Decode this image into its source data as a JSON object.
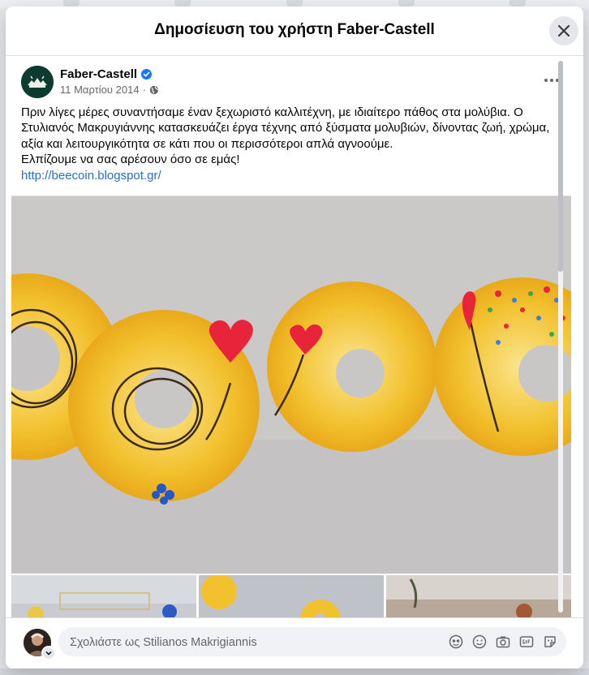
{
  "modal": {
    "title": "Δημοσίευση του χρήστη Faber-Castell"
  },
  "post": {
    "page_name": "Faber-Castell",
    "date": "11 Μαρτίου 2014",
    "separator": "·",
    "text_lines": [
      "Πριν λίγες μέρες συναντήσαμε έναν ξεχωριστό καλλιτέχνη, με ιδιαίτερο πάθος στα μολύβια. Ο Στυλιανός Μακρυγιάννης κατασκευάζει έργα τέχνης από ξύσματα μολυβιών, δίνοντας ζωή, χρώμα, αξία και λειτουργικότητα σε κάτι που οι περισσότεροι απλά αγνοούμε.",
      "Ελπίζουμε να σας αρέσουν όσο σε εμάς!"
    ],
    "link": "http://beecoin.blogspot.gr/"
  },
  "comment": {
    "placeholder": "Σχολιάστε ως Stilianos Makrigiannis"
  },
  "colors": {
    "accent": "#1877f2",
    "link": "#216fdb",
    "shavings": "#f2c12e",
    "heart": "#e8243a"
  },
  "icons": [
    "close-icon",
    "verified-icon",
    "globe-icon",
    "more-icon",
    "avatar-icon",
    "chevron-down-icon",
    "avatar-sticker-icon",
    "emoji-icon",
    "camera-icon",
    "gif-icon",
    "sticker-icon"
  ]
}
